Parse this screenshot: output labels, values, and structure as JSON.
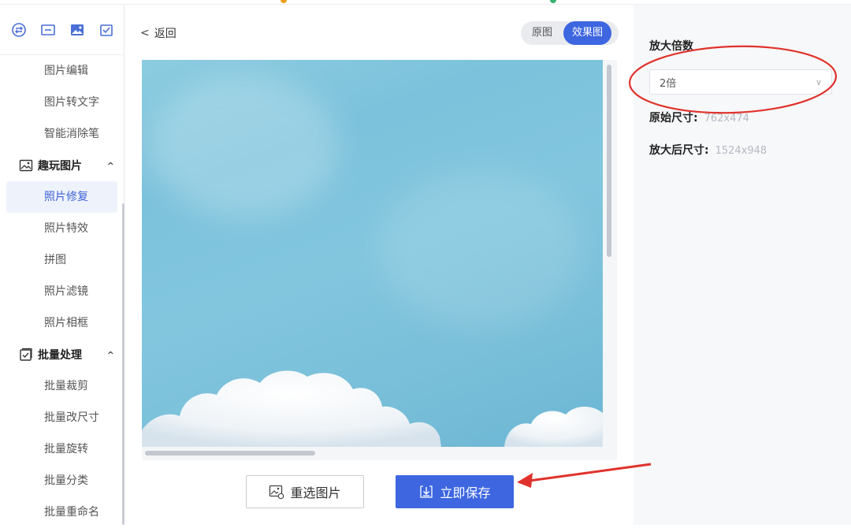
{
  "sidebar": {
    "tool_icons": [
      "exchange-icon",
      "crop-icon",
      "image-icon",
      "checklist-icon"
    ],
    "items_top": [
      "图片编辑",
      "图片转文字",
      "智能消除笔"
    ],
    "group_fun": {
      "label": "趣玩图片",
      "items": [
        "照片修复",
        "照片特效",
        "拼图",
        "照片滤镜",
        "照片相框"
      ]
    },
    "group_batch": {
      "label": "批量处理",
      "items": [
        "批量裁剪",
        "批量改尺寸",
        "批量旋转",
        "批量分类",
        "批量重命名"
      ]
    }
  },
  "main": {
    "back_label": "返回",
    "toggle": {
      "original": "原图",
      "effect": "效果图"
    },
    "reselect_label": "重选图片",
    "save_label": "立即保存"
  },
  "panel": {
    "scale_label": "放大倍数",
    "scale_value": "2倍",
    "original_size_label": "原始尺寸:",
    "original_size_value": "762x474",
    "enlarged_size_label": "放大后尺寸:",
    "enlarged_size_value": "1524x948"
  },
  "colors": {
    "accent": "#3d66e0",
    "annotation": "#e0322c"
  }
}
